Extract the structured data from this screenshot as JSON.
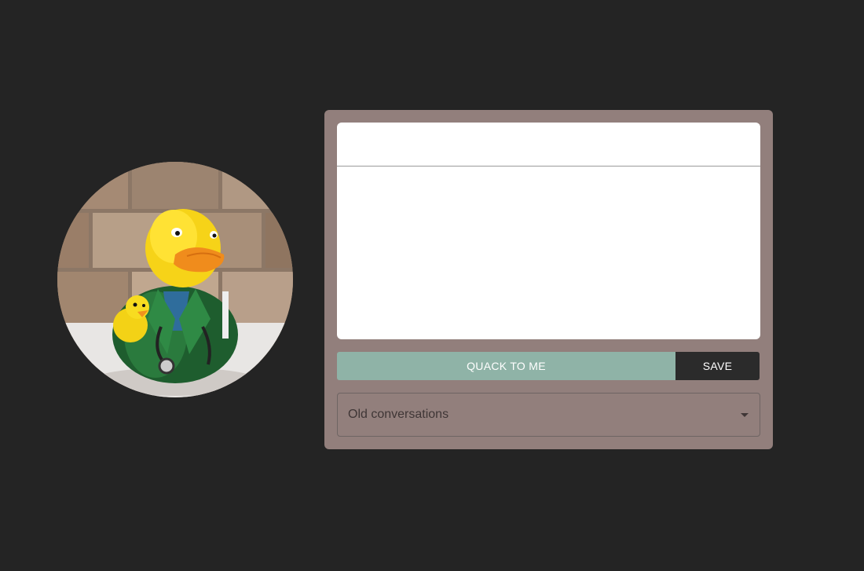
{
  "avatar": {
    "description_icon": "rubber-duck-doctor-photo"
  },
  "chat": {
    "input_value": "",
    "input_placeholder": "",
    "conversation_text": ""
  },
  "actions": {
    "quack_label": "QUACK TO ME",
    "save_label": "SAVE"
  },
  "history": {
    "select_label": "Old conversations"
  },
  "colors": {
    "background": "#242424",
    "panel": "#927f7c",
    "quack_button": "#8fb3a7",
    "save_button": "#2b2b2b"
  }
}
